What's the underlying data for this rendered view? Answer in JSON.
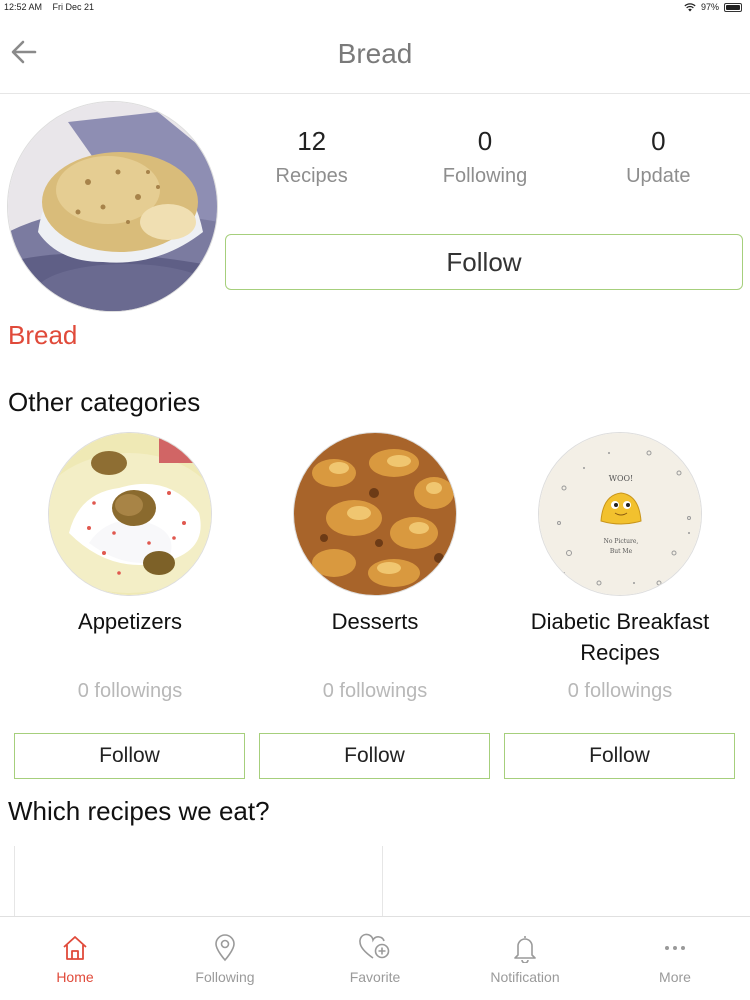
{
  "status_bar": {
    "time": "12:52 AM",
    "date": "Fri Dec 21",
    "battery": "97%",
    "battery_level": 0.97
  },
  "nav": {
    "title": "Bread"
  },
  "profile": {
    "name": "Bread",
    "stats": [
      {
        "value": "12",
        "label": "Recipes"
      },
      {
        "value": "0",
        "label": "Following"
      },
      {
        "value": "0",
        "label": "Update"
      }
    ],
    "follow_label": "Follow"
  },
  "other_categories": {
    "title": "Other categories",
    "items": [
      {
        "name": "Appetizers",
        "followings": "0 followings",
        "button": "Follow"
      },
      {
        "name": "Desserts",
        "followings": "0 followings",
        "button": "Follow"
      },
      {
        "name": "Diabetic Breakfast Recipes",
        "followings": "0 followings",
        "button": "Follow",
        "placeholder_text": "WOO! No Picture, But Me"
      }
    ]
  },
  "recipes_section": {
    "title": "Which recipes we eat?"
  },
  "tabs": [
    {
      "label": "Home",
      "icon": "home-icon",
      "active": true
    },
    {
      "label": "Following",
      "icon": "location-pin-icon"
    },
    {
      "label": "Favorite",
      "icon": "heart-plus-icon"
    },
    {
      "label": "Notification",
      "icon": "bell-icon"
    },
    {
      "label": "More",
      "icon": "more-dots-icon"
    }
  ],
  "colors": {
    "accent": "#e04a3a",
    "border_green": "#a6cf7c",
    "muted": "#9a9a9a"
  }
}
